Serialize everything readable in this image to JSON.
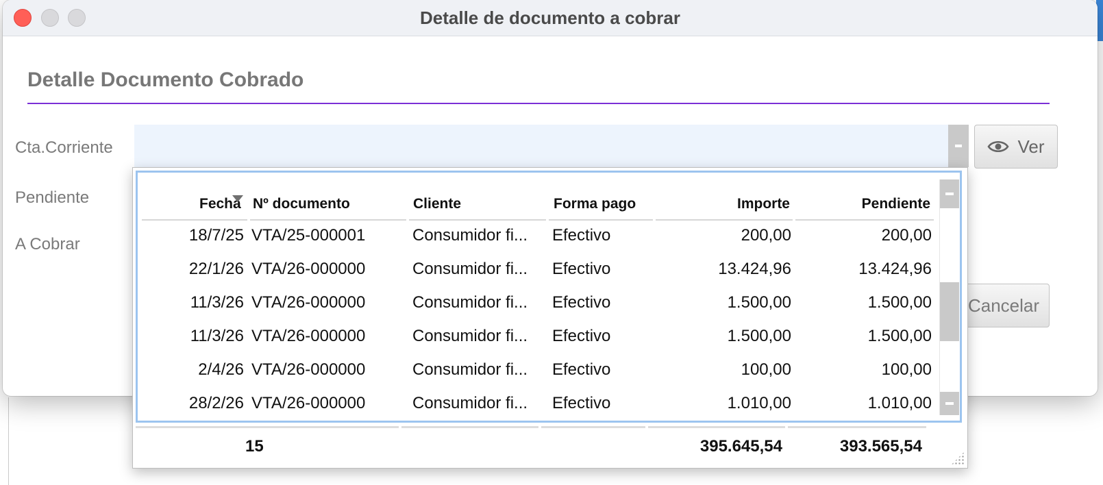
{
  "window": {
    "title": "Detalle de documento a cobrar"
  },
  "form": {
    "heading": "Detalle Documento Cobrado",
    "labels": {
      "cta_corriente": "Cta.Corriente",
      "pendiente": "Pendiente",
      "a_cobrar": "A Cobrar"
    },
    "ver_button": "Ver",
    "cancel_button_visible": "Cancelar",
    "accent_color": "#7b2fd6"
  },
  "popup": {
    "columns": {
      "fecha": "Fecha",
      "documento": "Nº documento",
      "cliente": "Cliente",
      "forma_pago": "Forma pago",
      "importe": "Importe",
      "pendiente": "Pendiente"
    },
    "sort_column": "Fecha",
    "rows": [
      {
        "fecha": "18/7/25",
        "documento": "VTA/25-000001",
        "cliente": "Consumidor fi...",
        "forma_pago": "Efectivo",
        "importe": "200,00",
        "pendiente": "200,00"
      },
      {
        "fecha": "22/1/26",
        "documento": "VTA/26-000000",
        "cliente": "Consumidor fi...",
        "forma_pago": "Efectivo",
        "importe": "13.424,96",
        "pendiente": "13.424,96"
      },
      {
        "fecha": "11/3/26",
        "documento": "VTA/26-000000",
        "cliente": "Consumidor fi...",
        "forma_pago": "Efectivo",
        "importe": "1.500,00",
        "pendiente": "1.500,00"
      },
      {
        "fecha": "11/3/26",
        "documento": "VTA/26-000000",
        "cliente": "Consumidor fi...",
        "forma_pago": "Efectivo",
        "importe": "1.500,00",
        "pendiente": "1.500,00"
      },
      {
        "fecha": "2/4/26",
        "documento": "VTA/26-000000",
        "cliente": "Consumidor fi...",
        "forma_pago": "Efectivo",
        "importe": "100,00",
        "pendiente": "100,00"
      },
      {
        "fecha": "28/2/26",
        "documento": "VTA/26-000000",
        "cliente": "Consumidor fi...",
        "forma_pago": "Efectivo",
        "importe": "1.010,00",
        "pendiente": "1.010,00"
      }
    ],
    "totals": {
      "count": "15",
      "importe": "395.645,54",
      "pendiente": "393.565,54"
    }
  }
}
